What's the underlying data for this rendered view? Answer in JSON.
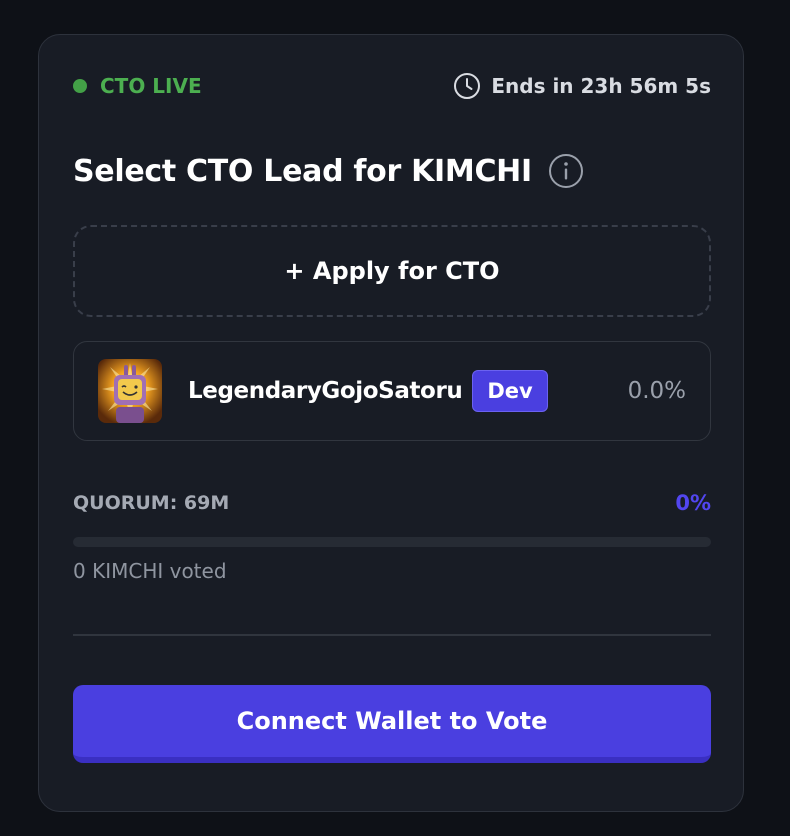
{
  "status": {
    "live_label": "CTO LIVE",
    "timer_label": "Ends in 23h 56m 5s",
    "live_color": "#43a047"
  },
  "header": {
    "title": "Select CTO Lead for KIMCHI",
    "info_icon": "info-icon"
  },
  "apply": {
    "label": "+ Apply for CTO"
  },
  "candidates": [
    {
      "name": "LegendaryGojoSatoru",
      "badge": "Dev",
      "percent": "0.0%"
    }
  ],
  "quorum": {
    "label": "QUORUM: 69M",
    "percent": "0%",
    "progress": 0,
    "voted_text": "0 KIMCHI voted"
  },
  "actions": {
    "connect_label": "Connect Wallet to Vote"
  },
  "colors": {
    "accent": "#4a3fe0",
    "background": "#181c25"
  }
}
